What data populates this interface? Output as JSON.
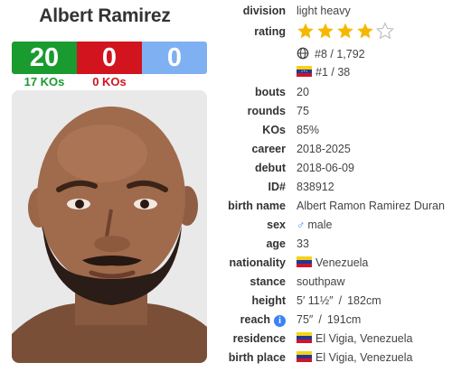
{
  "fighter": {
    "name": "Albert Ramirez",
    "record": {
      "wins": "20",
      "losses": "0",
      "draws": "0"
    },
    "kos": {
      "wins": "17 KOs",
      "losses": "0 KOs"
    }
  },
  "colors": {
    "win": "#1a9b2f",
    "loss": "#d2141f",
    "draw": "#7fb0f2",
    "star": "#f5b800",
    "male": "#3b82f6"
  },
  "details": {
    "division": {
      "label": "division",
      "value": "light heavy"
    },
    "rating": {
      "label": "rating",
      "stars_filled": 4,
      "stars_total": 5
    },
    "rank_world": {
      "icon": "globe-icon",
      "value": "#8 / 1,792"
    },
    "rank_country": {
      "icon": "venezuela-flag-icon",
      "value": "#1 / 38"
    },
    "bouts": {
      "label": "bouts",
      "value": "20"
    },
    "rounds": {
      "label": "rounds",
      "value": "75"
    },
    "kos": {
      "label": "KOs",
      "value": "85%"
    },
    "career": {
      "label": "career",
      "value": "2018-2025"
    },
    "debut": {
      "label": "debut",
      "value": "2018-06-09"
    },
    "id": {
      "label": "ID#",
      "value": "838912"
    },
    "birth_name": {
      "label": "birth name",
      "value": "Albert Ramon Ramirez Duran"
    },
    "sex": {
      "label": "sex",
      "icon": "male-icon",
      "value": "male"
    },
    "age": {
      "label": "age",
      "value": "33"
    },
    "nationality": {
      "label": "nationality",
      "value": "Venezuela"
    },
    "stance": {
      "label": "stance",
      "value": "southpaw"
    },
    "height": {
      "label": "height",
      "value_imperial": "5′ 11½″",
      "separator": "/",
      "value_metric": "182cm"
    },
    "reach": {
      "label": "reach",
      "value_imperial": "75″",
      "separator": "/",
      "value_metric": "191cm"
    },
    "residence": {
      "label": "residence",
      "value": "El Vigia, Venezuela"
    },
    "birth_place": {
      "label": "birth place",
      "value": "El Vigia, Venezuela"
    }
  }
}
